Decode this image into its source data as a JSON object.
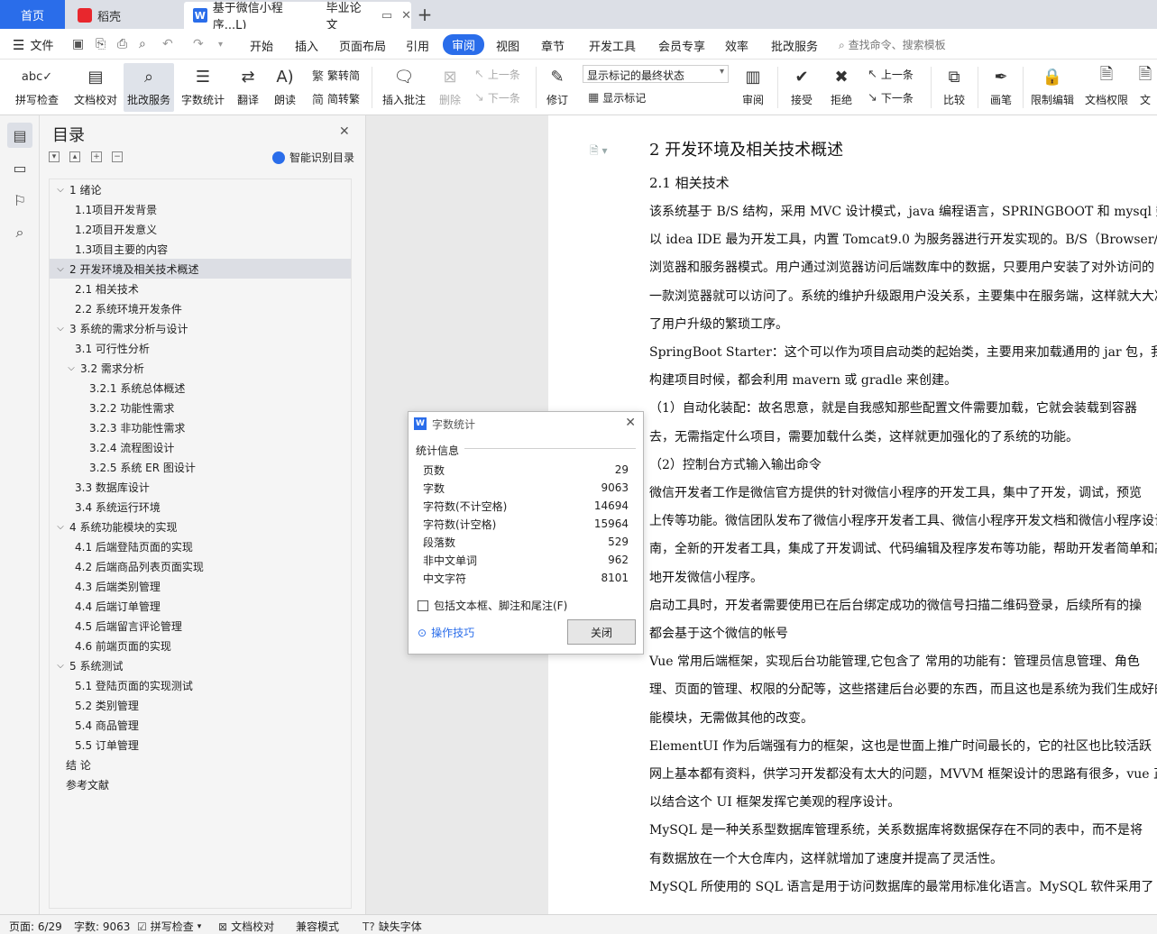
{
  "tabbar": {
    "home": "首页",
    "tab1": "稻壳",
    "tab2": "基于微信小程序...L)",
    "tab2_extra": "毕业论文",
    "new_tab": "+"
  },
  "menu": {
    "file": "文件",
    "items": [
      "开始",
      "插入",
      "页面布局",
      "引用",
      "审阅",
      "视图",
      "章节",
      "开发工具",
      "会员专享",
      "效率",
      "批改服务"
    ],
    "search": "查找命令、搜索模板"
  },
  "ribbon": {
    "spell": "拼写检查",
    "proof": "文档校对",
    "revise_service": "批改服务",
    "word_count": "字数统计",
    "translate": "翻译",
    "read_aloud": "朗读",
    "trad": "繁转简",
    "simp": "简转繁",
    "insert_comment": "插入批注",
    "delete": "删除",
    "prev": "上一条",
    "next": "下一条",
    "track": "修订",
    "markup_select": "显示标记的最终状态",
    "show_markup": "显示标记",
    "review": "审阅",
    "accept": "接受",
    "reject": "拒绝",
    "prev2": "上一条",
    "next2": "下一条",
    "compare": "比较",
    "pen": "画笔",
    "restrict": "限制编辑",
    "perm": "文档权限",
    "more": "文"
  },
  "toc": {
    "title": "目录",
    "smart": "智能识别目录",
    "items": [
      {
        "text": "1  绪论",
        "level": 0,
        "arrow": true
      },
      {
        "text": "1.1项目开发背景",
        "level": 1
      },
      {
        "text": "1.2项目开发意义",
        "level": 1
      },
      {
        "text": "1.3项目主要的内容",
        "level": 1
      },
      {
        "text": "2  开发环境及相关技术概述",
        "level": 0,
        "arrow": true,
        "selected": true
      },
      {
        "text": "2.1  相关技术",
        "level": 1
      },
      {
        "text": "2.2  系统环境开发条件",
        "level": 1
      },
      {
        "text": "3  系统的需求分析与设计",
        "level": 0,
        "arrow": true
      },
      {
        "text": "3.1 可行性分析",
        "level": 1
      },
      {
        "text": "3.2 需求分析",
        "level": 1,
        "arrow": true
      },
      {
        "text": "3.2.1 系统总体概述",
        "level": 2
      },
      {
        "text": "3.2.2 功能性需求",
        "level": 2
      },
      {
        "text": "3.2.3 非功能性需求",
        "level": 2
      },
      {
        "text": "3.2.4 流程图设计",
        "level": 2
      },
      {
        "text": "3.2.5 系统 ER 图设计",
        "level": 2
      },
      {
        "text": "3.3  数据库设计",
        "level": 1
      },
      {
        "text": "3.4 系统运行环境",
        "level": 1
      },
      {
        "text": "4  系统功能模块的实现",
        "level": 0,
        "arrow": true
      },
      {
        "text": "4.1  后端登陆页面的实现",
        "level": 1
      },
      {
        "text": "4.2 后端商品列表页面实现",
        "level": 1
      },
      {
        "text": "4.3  后端类别管理",
        "level": 1
      },
      {
        "text": "4.4  后端订单管理",
        "level": 1
      },
      {
        "text": "4.5  后端留言评论管理",
        "level": 1
      },
      {
        "text": "4.6  前端页面的实现",
        "level": 1
      },
      {
        "text": "5  系统测试",
        "level": 0,
        "arrow": true
      },
      {
        "text": "5.1  登陆页面的实现测试",
        "level": 1
      },
      {
        "text": "5.2  类别管理",
        "level": 1
      },
      {
        "text": "5.4  商品管理",
        "level": 1
      },
      {
        "text": "5.5  订单管理",
        "level": 1
      },
      {
        "text": "结    论",
        "level": 3
      },
      {
        "text": "参考文献",
        "level": 3
      }
    ]
  },
  "doc": {
    "h1": "2  开发环境及相关技术概述",
    "h2": "2.1  相关技术",
    "lines": [
      "    该系统基于 B/S 结构，采用 MVC 设计模式，java 编程语言，SPRINGBOOT 和 mysql 数据",
      "以 idea IDE 最为开发工具，内置 Tomcat9.0 为服务器进行开发实现的。B/S（Browser/Server）",
      "浏览器和服务器模式。用户通过浏览器访问后端数库中的数据，只要用户安装了对外访问的",
      "一款浏览器就可以访问了。系统的维护升级跟用户没关系，主要集中在服务端，这样就大大减",
      "了用户升级的繁琐工序。",
      "    SpringBoot Starter：这个可以作为项目启动类的起始类，主要用来加载通用的 jar 包，我们",
      "构建项目时候，都会利用 mavern 或 gradle 来创建。",
      "    （1）自动化装配：故名思意，就是自我感知那些配置文件需要加载，它就会装载到容器",
      "去，无需指定什么项目，需要加载什么类，这样就更加强化的了系统的功能。",
      "    （2）控制台方式输入输出命令",
      "    微信开发者工作是微信官方提供的针对微信小程序的开发工具，集中了开发，调试，预览",
      "上传等功能。微信团队发布了微信小程序开发者工具、微信小程序开发文档和微信小程序设计",
      "南，全新的开发者工具，集成了开发调试、代码编辑及程序发布等功能，帮助开发者简单和高",
      "地开发微信小程序。",
      "    启动工具时，开发者需要使用已在后台绑定成功的微信号扫描二维码登录，后续所有的操",
      "都会基于这个微信的帐号",
      "    Vue 常用后端框架，实现后台功能管理,它包含了 常用的功能有：管理员信息管理、角色",
      "理、页面的管理、权限的分配等，这些搭建后台必要的东西，而且这也是系统为我们生成好的",
      "能模块，无需做其他的改变。",
      "    ElementUI 作为后端强有力的框架，这也是世面上推广时间最长的，它的社区也比较活跃",
      "网上基本都有资料，供学习开发都没有太大的问题，MVVM 框架设计的思路有很多，vue 正好",
      "以结合这个 UI 框架发挥它美观的程序设计。",
      "    MySQL 是一种关系型数据库管理系统，关系数据库将数据保存在不同的表中，而不是将",
      "有数据放在一个大仓库内，这样就增加了速度并提高了灵活性。",
      "    MySQL 所使用的  SQL  语言是用于访问数据库的最常用标准化语言。MySQL 软件采用了"
    ]
  },
  "dialog": {
    "title": "字数统计",
    "section": "统计信息",
    "rows": [
      {
        "label": "页数",
        "value": "29"
      },
      {
        "label": "字数",
        "value": "9063"
      },
      {
        "label": "字符数(不计空格)",
        "value": "14694"
      },
      {
        "label": "字符数(计空格)",
        "value": "15964"
      },
      {
        "label": "段落数",
        "value": "529"
      },
      {
        "label": "非中文单词",
        "value": "962"
      },
      {
        "label": "中文字符",
        "value": "8101"
      }
    ],
    "checkbox": "包括文本框、脚注和尾注(F)",
    "tips": "操作技巧",
    "close": "关闭"
  },
  "status": {
    "page": "页面: 6/29",
    "words": "字数: 9063",
    "spell": "拼写检查",
    "proof": "文档校对",
    "compat": "兼容模式",
    "missing_font": "缺失字体"
  }
}
